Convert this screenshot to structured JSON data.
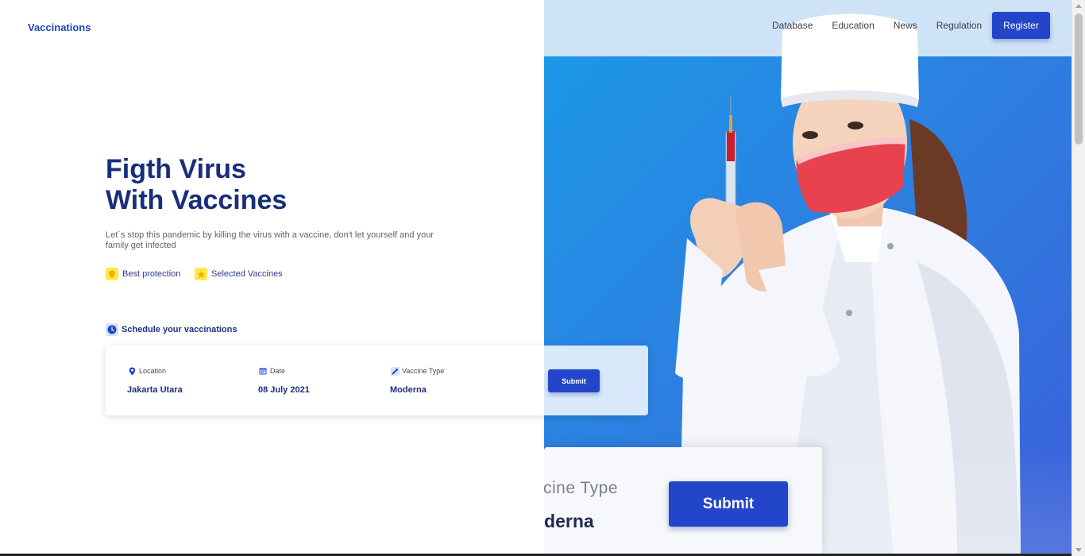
{
  "nav": {
    "brand": "Vaccinations",
    "links": [
      {
        "label": "Database"
      },
      {
        "label": "Education"
      },
      {
        "label": "News"
      },
      {
        "label": "Regulation"
      }
    ],
    "register_label": "Register"
  },
  "hero": {
    "headline_line1": "Figth Virus",
    "headline_line2": "With Vaccines",
    "subtext": "Let´s stop this pandemic by killing the virus with a vaccine, don't let yourself and your family get infected",
    "features": [
      {
        "label": "Best protection",
        "icon": "shield-icon"
      },
      {
        "label": "Selected Vaccines",
        "icon": "star-icon"
      }
    ]
  },
  "schedule": {
    "title": "Schedule your vaccinations",
    "fields": [
      {
        "label": "Location",
        "value": "Jakarta Utara",
        "icon": "location-pin-icon"
      },
      {
        "label": "Date",
        "value": "08 July 2021",
        "icon": "calendar-icon"
      },
      {
        "label": "Vaccine Type",
        "value": "Moderna",
        "icon": "syringe-icon"
      }
    ],
    "submit_label": "Submit"
  },
  "hero_image": {
    "ghost_label": "ccine Type",
    "ghost_value": "oderna",
    "ghost_submit": "Submit"
  },
  "colors": {
    "primary": "#2345c9",
    "heading": "#182e7a",
    "accent_yellow": "#ffe94a",
    "hero_blue": "#2f7ce0"
  }
}
